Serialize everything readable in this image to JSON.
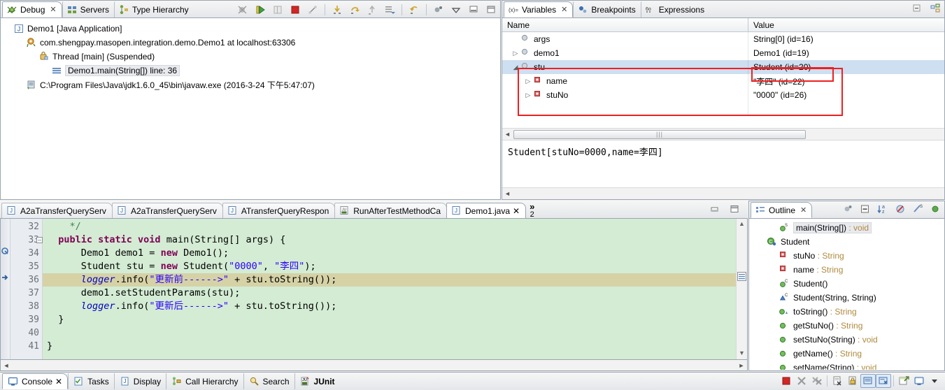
{
  "debug_view": {
    "tabs": [
      {
        "label": "Debug",
        "icon": "debug-icon",
        "active": true,
        "closable": true
      },
      {
        "label": "Servers",
        "icon": "servers-icon",
        "active": false
      },
      {
        "label": "Type Hierarchy",
        "icon": "type-hierarchy-icon",
        "active": false
      }
    ],
    "toolbar": [
      "skip-breakpoints-icon",
      "resume-icon",
      "suspend-icon",
      "terminate-icon",
      "disconnect-icon",
      "step-into-icon",
      "step-over-icon",
      "step-return-icon",
      "drop-to-frame-icon",
      "use-step-filters-icon",
      "view-menu-icon",
      "minimize-icon",
      "maximize-icon"
    ],
    "tree": [
      {
        "indent": 0,
        "icon": "java-launch-icon",
        "label": "Demo1 [Java Application]",
        "selected": false
      },
      {
        "indent": 1,
        "icon": "debug-target-icon",
        "label": "com.shengpay.masopen.integration.demo.Demo1 at localhost:63306",
        "selected": false
      },
      {
        "indent": 2,
        "icon": "thread-suspended-icon",
        "label": "Thread [main] (Suspended)",
        "selected": false
      },
      {
        "indent": 3,
        "icon": "stack-frame-icon",
        "label": "Demo1.main(String[]) line: 36",
        "selected": true
      },
      {
        "indent": 1,
        "icon": "process-icon",
        "label": "C:\\Program Files\\Java\\jdk1.6.0_45\\bin\\javaw.exe (2016-3-24 下午5:47:07)",
        "selected": false
      }
    ]
  },
  "variables_view": {
    "tabs": [
      {
        "label": "Variables",
        "icon": "variables-icon",
        "active": true,
        "closable": true
      },
      {
        "label": "Breakpoints",
        "icon": "breakpoints-icon",
        "active": false
      },
      {
        "label": "Expressions",
        "icon": "expressions-icon",
        "active": false
      }
    ],
    "toolbar": [
      "collapse-all-icon",
      "show-logical-structure-icon"
    ],
    "columns": [
      "Name",
      "Value"
    ],
    "rows": [
      {
        "indent": 1,
        "expander": "",
        "icon": "local-variable-icon",
        "name": "args",
        "value": "String[0]  (id=16)",
        "selected": false
      },
      {
        "indent": 1,
        "expander": "▷",
        "icon": "local-variable-icon",
        "name": "demo1",
        "value": "Demo1  (id=19)",
        "selected": false
      },
      {
        "indent": 1,
        "expander": "◢",
        "icon": "local-variable-icon",
        "name": "stu",
        "value": "Student  (id=20)",
        "selected": true
      },
      {
        "indent": 2,
        "expander": "▷",
        "icon": "private-field-icon",
        "name": "name",
        "value": "\"李四\" (id=22)",
        "selected": false
      },
      {
        "indent": 2,
        "expander": "▷",
        "icon": "private-field-icon",
        "name": "stuNo",
        "value": "\"0000\" (id=26)",
        "selected": false
      }
    ],
    "detail_text": "Student[stuNo=0000,name=李四]",
    "highlight_color": "#ef1f1f"
  },
  "editor": {
    "tabs": [
      {
        "label": "A2aTransferQueryServ",
        "icon": "java-file-icon",
        "active": false
      },
      {
        "label": "A2aTransferQueryServ",
        "icon": "java-file-icon",
        "active": false
      },
      {
        "label": "ATransferQueryRespon",
        "icon": "java-file-icon",
        "active": false
      },
      {
        "label": "RunAfterTestMethodCa",
        "icon": "junit-file-icon",
        "active": false
      },
      {
        "label": "Demo1.java",
        "icon": "java-file-icon",
        "active": true,
        "closable": true
      }
    ],
    "more_tabs_count": "2",
    "more_tabs_glyph": "»",
    "window_buttons": [
      "restore-icon",
      "maximize-icon"
    ],
    "current_line": 36,
    "lines": [
      {
        "num": "32",
        "marker": "",
        "fold": false,
        "tokens": [
          {
            "t": "    ",
            "c": ""
          },
          {
            "t": "*/",
            "c": "cmt"
          }
        ]
      },
      {
        "num": "33",
        "marker": "",
        "fold": true,
        "tokens": [
          {
            "t": "  ",
            "c": ""
          },
          {
            "t": "public static void ",
            "c": "kw"
          },
          {
            "t": "main(String[] args) {",
            "c": ""
          }
        ]
      },
      {
        "num": "34",
        "marker": "step-marker",
        "fold": false,
        "tokens": [
          {
            "t": "      Demo1 demo1 = ",
            "c": ""
          },
          {
            "t": "new ",
            "c": "kw"
          },
          {
            "t": "Demo1();",
            "c": ""
          }
        ]
      },
      {
        "num": "35",
        "marker": "",
        "fold": false,
        "tokens": [
          {
            "t": "      Student stu = ",
            "c": ""
          },
          {
            "t": "new ",
            "c": "kw"
          },
          {
            "t": "Student(",
            "c": ""
          },
          {
            "t": "\"0000\"",
            "c": "str"
          },
          {
            "t": ", ",
            "c": ""
          },
          {
            "t": "\"李四\"",
            "c": "str"
          },
          {
            "t": ");",
            "c": ""
          }
        ]
      },
      {
        "num": "36",
        "marker": "instruction-pointer",
        "fold": false,
        "tokens": [
          {
            "t": "      ",
            "c": ""
          },
          {
            "t": "logger",
            "c": "fld"
          },
          {
            "t": ".info(",
            "c": ""
          },
          {
            "t": "\"更新前------>\"",
            "c": "str"
          },
          {
            "t": " + stu.toString());",
            "c": ""
          }
        ]
      },
      {
        "num": "37",
        "marker": "",
        "fold": false,
        "tokens": [
          {
            "t": "      demo1.setStudentParams(stu);",
            "c": ""
          }
        ]
      },
      {
        "num": "38",
        "marker": "",
        "fold": false,
        "tokens": [
          {
            "t": "      ",
            "c": ""
          },
          {
            "t": "logger",
            "c": "fld"
          },
          {
            "t": ".info(",
            "c": ""
          },
          {
            "t": "\"更新后------>\"",
            "c": "str"
          },
          {
            "t": " + stu.toString());",
            "c": ""
          }
        ]
      },
      {
        "num": "39",
        "marker": "",
        "fold": false,
        "tokens": [
          {
            "t": "  }",
            "c": ""
          }
        ]
      },
      {
        "num": "40",
        "marker": "",
        "fold": false,
        "tokens": [
          {
            "t": "",
            "c": ""
          }
        ]
      },
      {
        "num": "41",
        "marker": "",
        "fold": false,
        "tokens": [
          {
            "t": "}",
            "c": ""
          }
        ]
      }
    ]
  },
  "outline_view": {
    "tab": {
      "label": "Outline",
      "icon": "outline-icon",
      "closable": true
    },
    "toolbar": [
      "focus-on-active-task-icon",
      "collapse-all-icon",
      "sort-icon",
      "hide-fields-icon",
      "hide-static-icon",
      "hide-nonpublic-icon"
    ],
    "rows": [
      {
        "indent": 2,
        "icon": "public-method-static-icon",
        "label": "main(String[])",
        "suffix": " : void",
        "suffix_class": "ovoid",
        "selected": true
      },
      {
        "indent": 1,
        "icon": "class-icon",
        "label": "Student",
        "suffix": "",
        "suffix_class": "",
        "selected": false
      },
      {
        "indent": 2,
        "icon": "private-field-icon",
        "label": "stuNo",
        "suffix": " : String",
        "suffix_class": "otype",
        "selected": false
      },
      {
        "indent": 2,
        "icon": "private-field-icon",
        "label": "name",
        "suffix": " : String",
        "suffix_class": "otype",
        "selected": false
      },
      {
        "indent": 2,
        "icon": "public-constructor-icon",
        "label": "Student()",
        "suffix": "",
        "suffix_class": "",
        "selected": false
      },
      {
        "indent": 2,
        "icon": "protected-constructor-icon",
        "label": "Student(String, String)",
        "suffix": "",
        "suffix_class": "",
        "selected": false
      },
      {
        "indent": 2,
        "icon": "public-method-override-icon",
        "label": "toString()",
        "suffix": " : String",
        "suffix_class": "otype",
        "selected": false
      },
      {
        "indent": 2,
        "icon": "public-method-icon",
        "label": "getStuNo()",
        "suffix": " : String",
        "suffix_class": "otype",
        "selected": false
      },
      {
        "indent": 2,
        "icon": "public-method-icon",
        "label": "setStuNo(String)",
        "suffix": " : void",
        "suffix_class": "ovoid",
        "selected": false
      },
      {
        "indent": 2,
        "icon": "public-method-icon",
        "label": "getName()",
        "suffix": " : String",
        "suffix_class": "otype",
        "selected": false
      },
      {
        "indent": 2,
        "icon": "public-method-icon",
        "label": "setName(String)",
        "suffix": " : void",
        "suffix_class": "ovoid",
        "selected": false
      }
    ]
  },
  "bottom_view": {
    "tabs": [
      {
        "label": "Console",
        "icon": "console-icon",
        "active": true,
        "closable": true
      },
      {
        "label": "Tasks",
        "icon": "tasks-icon",
        "active": false
      },
      {
        "label": "Display",
        "icon": "display-icon",
        "active": false
      },
      {
        "label": "Call Hierarchy",
        "icon": "call-hierarchy-icon",
        "active": false
      },
      {
        "label": "Search",
        "icon": "search-icon",
        "active": false
      },
      {
        "label": "JUnit",
        "icon": "junit-icon",
        "active": false
      }
    ],
    "toolbar": [
      "terminate-icon",
      "remove-launch-icon",
      "remove-all-launches-icon",
      "clear-console-icon",
      "scroll-lock-icon",
      "pin-console-icon",
      "display-selected-console-icon",
      "open-console-icon",
      "console-menu-icon"
    ]
  }
}
